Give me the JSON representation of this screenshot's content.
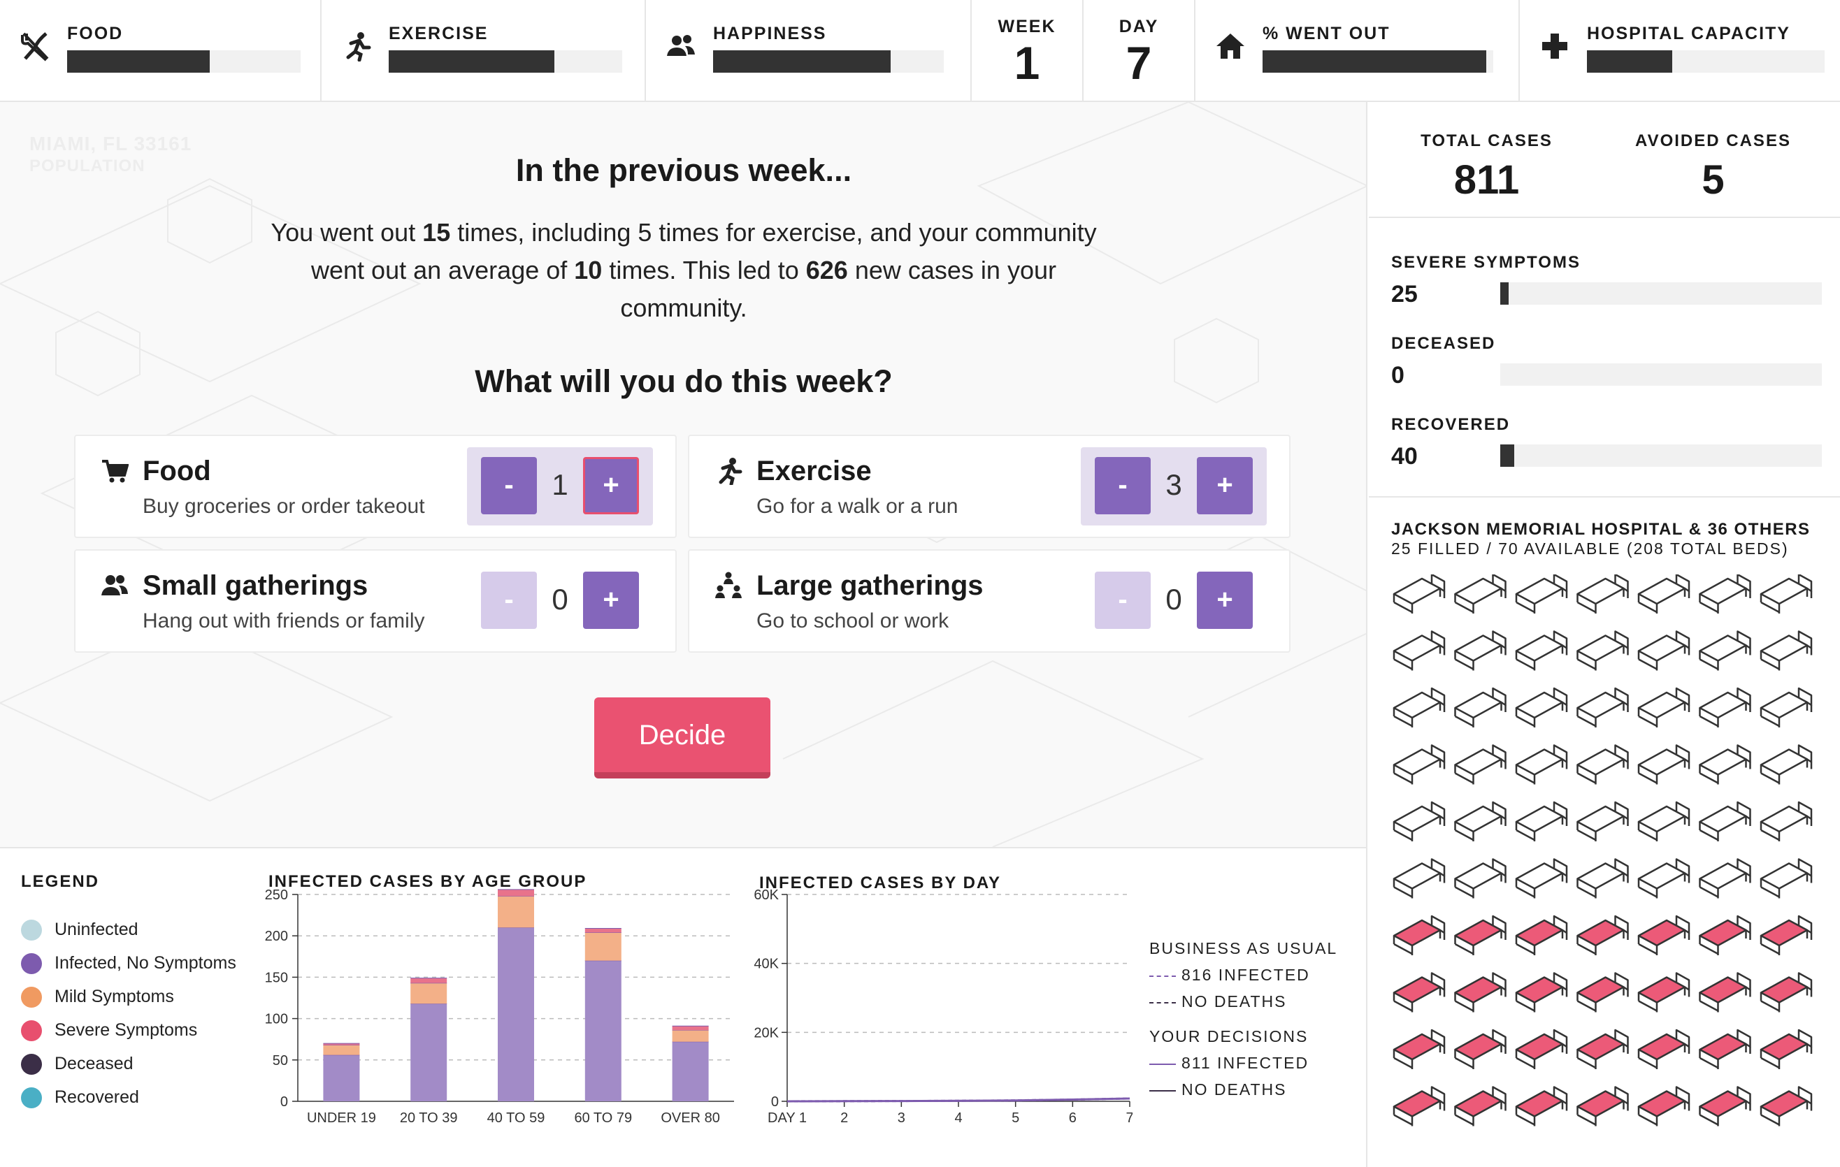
{
  "topbar": {
    "food": {
      "label": "FOOD",
      "level": 0.61
    },
    "exercise": {
      "label": "EXERCISE",
      "level": 0.71
    },
    "happiness": {
      "label": "HAPPINESS",
      "level": 0.77
    },
    "week": {
      "label": "WEEK",
      "value": "1"
    },
    "day": {
      "label": "DAY",
      "value": "7"
    },
    "went_out": {
      "label": "% WENT OUT",
      "level": 0.97
    },
    "hospital": {
      "label": "HOSPITAL CAPACITY",
      "level": 0.36
    }
  },
  "main": {
    "ghost_location": "MIAMI, FL 33161",
    "ghost_population": "POPULATION",
    "prev_title": "In the previous week...",
    "summary": {
      "p1": "You went out ",
      "went_out": "15",
      "p2": " times, including 5 times for exercise, and your community went out an average of ",
      "community_avg": "10",
      "p3": " times. This led to ",
      "new_cases": "626",
      "p4": " new cases in your community."
    },
    "question": "What will you do this week?",
    "activities": [
      {
        "title": "Food",
        "subtitle": "Buy groceries or order takeout",
        "value": "1",
        "minus": "-",
        "plus": "+"
      },
      {
        "title": "Exercise",
        "subtitle": "Go for a walk or a run",
        "value": "3",
        "minus": "-",
        "plus": "+"
      },
      {
        "title": "Small gatherings",
        "subtitle": "Hang out with friends or family",
        "value": "0",
        "minus": "-",
        "plus": "+"
      },
      {
        "title": "Large gatherings",
        "subtitle": "Go to school or work",
        "value": "0",
        "minus": "-",
        "plus": "+"
      }
    ],
    "decide_label": "Decide"
  },
  "legend": {
    "title": "LEGEND",
    "items": [
      {
        "label": "Uninfected",
        "color": "#bcd8df"
      },
      {
        "label": "Infected, No Symptoms",
        "color": "#7d5bae"
      },
      {
        "label": "Mild Symptoms",
        "color": "#f09a61"
      },
      {
        "label": "Severe Symptoms",
        "color": "#e84f6e"
      },
      {
        "label": "Deceased",
        "color": "#3b2e47"
      },
      {
        "label": "Recovered",
        "color": "#4aafc5"
      }
    ]
  },
  "chart_data": [
    {
      "type": "bar",
      "title": "INFECTED CASES BY AGE GROUP",
      "categories": [
        "UNDER 19",
        "20 TO 39",
        "40 TO 59",
        "60 TO 79",
        "OVER 80"
      ],
      "series": [
        {
          "name": "Infected, No Symptoms",
          "color": "#a28bc7",
          "values": [
            56,
            118,
            210,
            170,
            72
          ]
        },
        {
          "name": "Mild Symptoms",
          "color": "#f3b088",
          "values": [
            12,
            25,
            38,
            34,
            14
          ]
        },
        {
          "name": "Severe Symptoms",
          "color": "#e8738b",
          "values": [
            2,
            6,
            8,
            5,
            5
          ]
        }
      ],
      "ylim": [
        0,
        250
      ],
      "yticks": [
        "0",
        "50",
        "100",
        "150",
        "200",
        "250"
      ]
    },
    {
      "type": "line",
      "title": "INFECTED CASES BY DAY",
      "x": [
        "DAY 1",
        "2",
        "3",
        "4",
        "5",
        "6",
        "7"
      ],
      "series": [
        {
          "name": "BUSINESS AS USUAL",
          "color": "#7d5bae",
          "dash": true,
          "values": [
            5,
            40,
            80,
            150,
            260,
            500,
            816
          ]
        },
        {
          "name": "YOUR DECISIONS",
          "color": "#7d5bae",
          "dash": false,
          "values": [
            5,
            40,
            80,
            150,
            260,
            500,
            811
          ]
        }
      ],
      "ylim": [
        0,
        60000
      ],
      "yticks": [
        "0",
        "20K",
        "40K",
        "60K"
      ]
    }
  ],
  "day_legend": {
    "bau_title": "BUSINESS AS USUAL",
    "bau_infected": "816 INFECTED",
    "bau_deaths": "NO DEATHS",
    "yd_title": "YOUR DECISIONS",
    "yd_infected": "811 INFECTED",
    "yd_deaths": "NO DEATHS"
  },
  "right": {
    "total_label": "TOTAL CASES",
    "total_value": "811",
    "avoided_label": "AVOIDED CASES",
    "avoided_value": "5",
    "severe": {
      "label": "SEVERE SYMPTOMS",
      "value": "25",
      "level": 0.027
    },
    "deceased": {
      "label": "DECEASED",
      "value": "0",
      "level": 0
    },
    "recovered": {
      "label": "RECOVERED",
      "value": "40",
      "level": 0.043
    },
    "hospital_name": "JACKSON MEMORIAL HOSPITAL & 36 OTHERS",
    "beds_text": "25 FILLED / 70 AVAILABLE (208 TOTAL BEDS)",
    "bed_rows": 10,
    "bed_cols": 7,
    "beds_filled_from_row": 6
  }
}
